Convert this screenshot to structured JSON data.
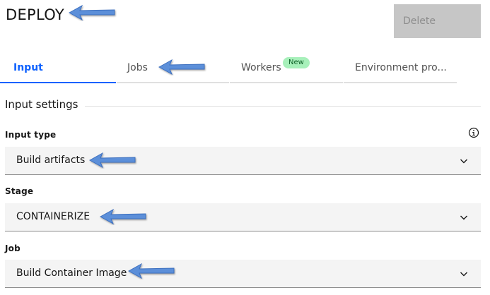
{
  "header": {
    "title": "DEPLOY",
    "delete_label": "Delete"
  },
  "tabs": [
    {
      "label": "Input",
      "active": true
    },
    {
      "label": "Jobs",
      "active": false
    },
    {
      "label": "Workers",
      "active": false,
      "badge": "New"
    },
    {
      "label": "Environment pro...",
      "active": false
    }
  ],
  "section": {
    "title": "Input settings"
  },
  "fields": {
    "input_type": {
      "label": "Input type",
      "value": "Build artifacts"
    },
    "stage": {
      "label": "Stage",
      "value": "CONTAINERIZE"
    },
    "job": {
      "label": "Job",
      "value": "Build Container Image"
    }
  },
  "icons": {
    "info": "info-icon",
    "chevron": "chevron-down-icon",
    "annotation": "arrow-left-icon"
  },
  "colors": {
    "accent": "#0f62fe",
    "arrow": "#5b8fd9",
    "badge_bg": "#a7f0ba",
    "field_bg": "#f4f4f4",
    "disabled_btn": "#c6c6c6"
  }
}
